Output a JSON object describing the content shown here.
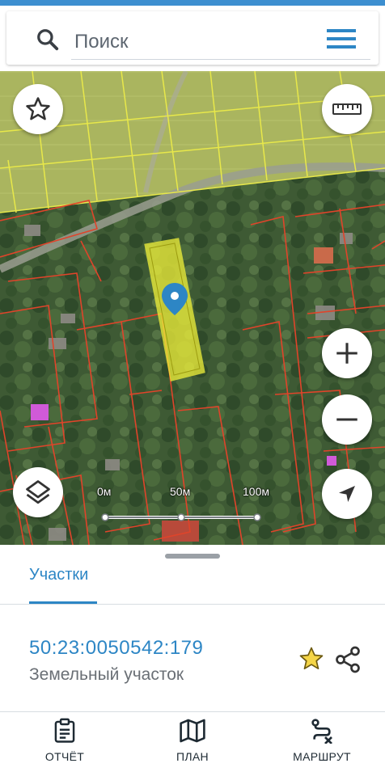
{
  "search": {
    "placeholder": "Поиск"
  },
  "map": {
    "scale_labels": [
      "0м",
      "50м",
      "100м"
    ]
  },
  "sheet": {
    "tab_label": "Участки",
    "parcel": {
      "cadastral_number": "50:23:0050542:179",
      "type": "Земельный участок"
    }
  },
  "bottom_nav": [
    {
      "label": "ОТЧЁТ",
      "icon": "report-icon"
    },
    {
      "label": "ПЛАН",
      "icon": "map-plan-icon"
    },
    {
      "label": "МАРШРУТ",
      "icon": "route-icon"
    }
  ],
  "colors": {
    "accent": "#2d86c5",
    "highlight_parcel": "#f2f23a",
    "parcel_border_red": "#e0442a",
    "parcel_border_yellow": "#e8e84a",
    "star": "#f5d547"
  }
}
